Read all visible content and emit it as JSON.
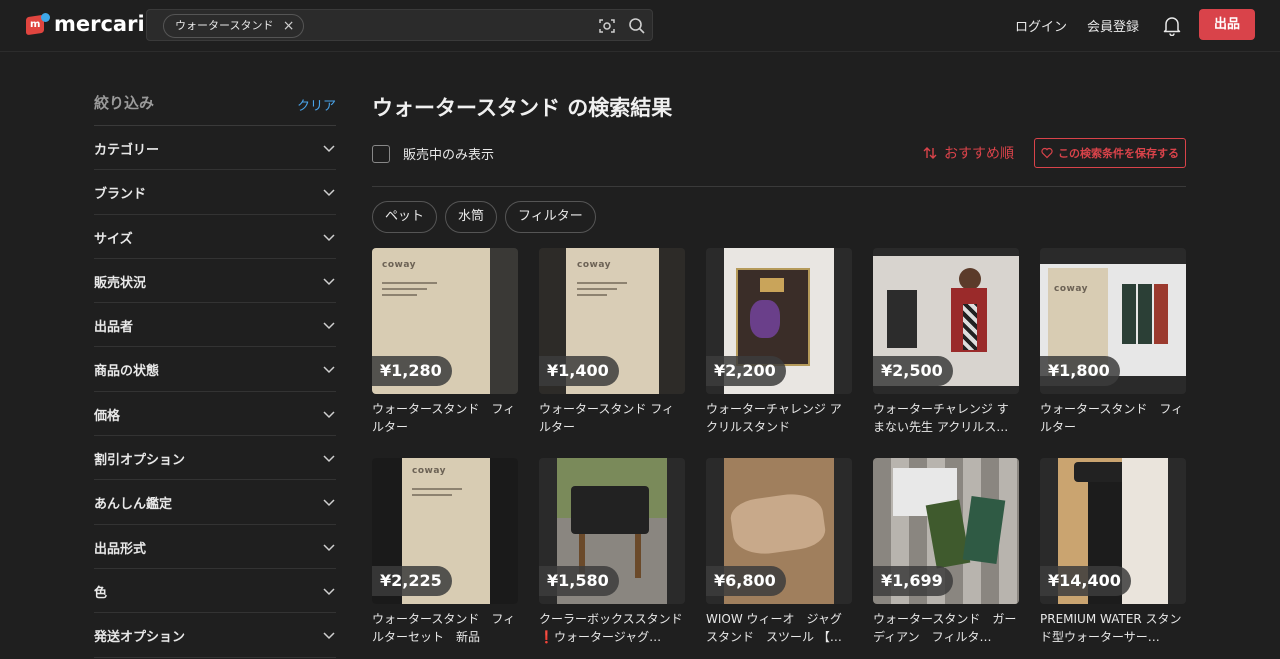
{
  "header": {
    "logo_text": "mercari",
    "search_query": "ウォータースタンド",
    "login": "ログイン",
    "signup": "会員登録",
    "sell": "出品"
  },
  "sidebar": {
    "title": "絞り込み",
    "clear": "クリア",
    "filters": [
      "カテゴリー",
      "ブランド",
      "サイズ",
      "販売状況",
      "出品者",
      "商品の状態",
      "価格",
      "割引オプション",
      "あんしん鑑定",
      "出品形式",
      "色",
      "発送オプション"
    ]
  },
  "main": {
    "title": "ウォータースタンド の検索結果",
    "on_sale_only": "販売中のみ表示",
    "sort": "おすすめ順",
    "save_search": "この検索条件を保存する",
    "tags": [
      "ペット",
      "水筒",
      "フィルター"
    ]
  },
  "items": [
    {
      "price": "¥1,280",
      "name": "ウォータースタンド　フィルター"
    },
    {
      "price": "¥1,400",
      "name": "ウォータースタンド フィルター"
    },
    {
      "price": "¥2,200",
      "name": "ウォーターチャレンジ アクリルスタンド"
    },
    {
      "price": "¥2,500",
      "name": "ウォーターチャレンジ すまない先生 アクリルス…"
    },
    {
      "price": "¥1,800",
      "name": "ウォータースタンド　フィルター"
    },
    {
      "price": "¥2,225",
      "name": "ウォータースタンド　フィルターセット　新品"
    },
    {
      "price": "¥1,580",
      "name": "クーラーボックススタンド❗️ウォータージャグ…"
    },
    {
      "price": "¥6,800",
      "name": "WIOW ウィーオ　ジャグスタンド　スツール 【…"
    },
    {
      "price": "¥1,699",
      "name": "ウォータースタンド　ガーディアン　フィルタ…"
    },
    {
      "price": "¥14,400",
      "name": "PREMIUM WATER スタンド型ウォーターサー…"
    }
  ],
  "colors": {
    "background": "#1f1f1f",
    "accent_red": "#d9434a",
    "link_blue": "#4aa3e8"
  }
}
